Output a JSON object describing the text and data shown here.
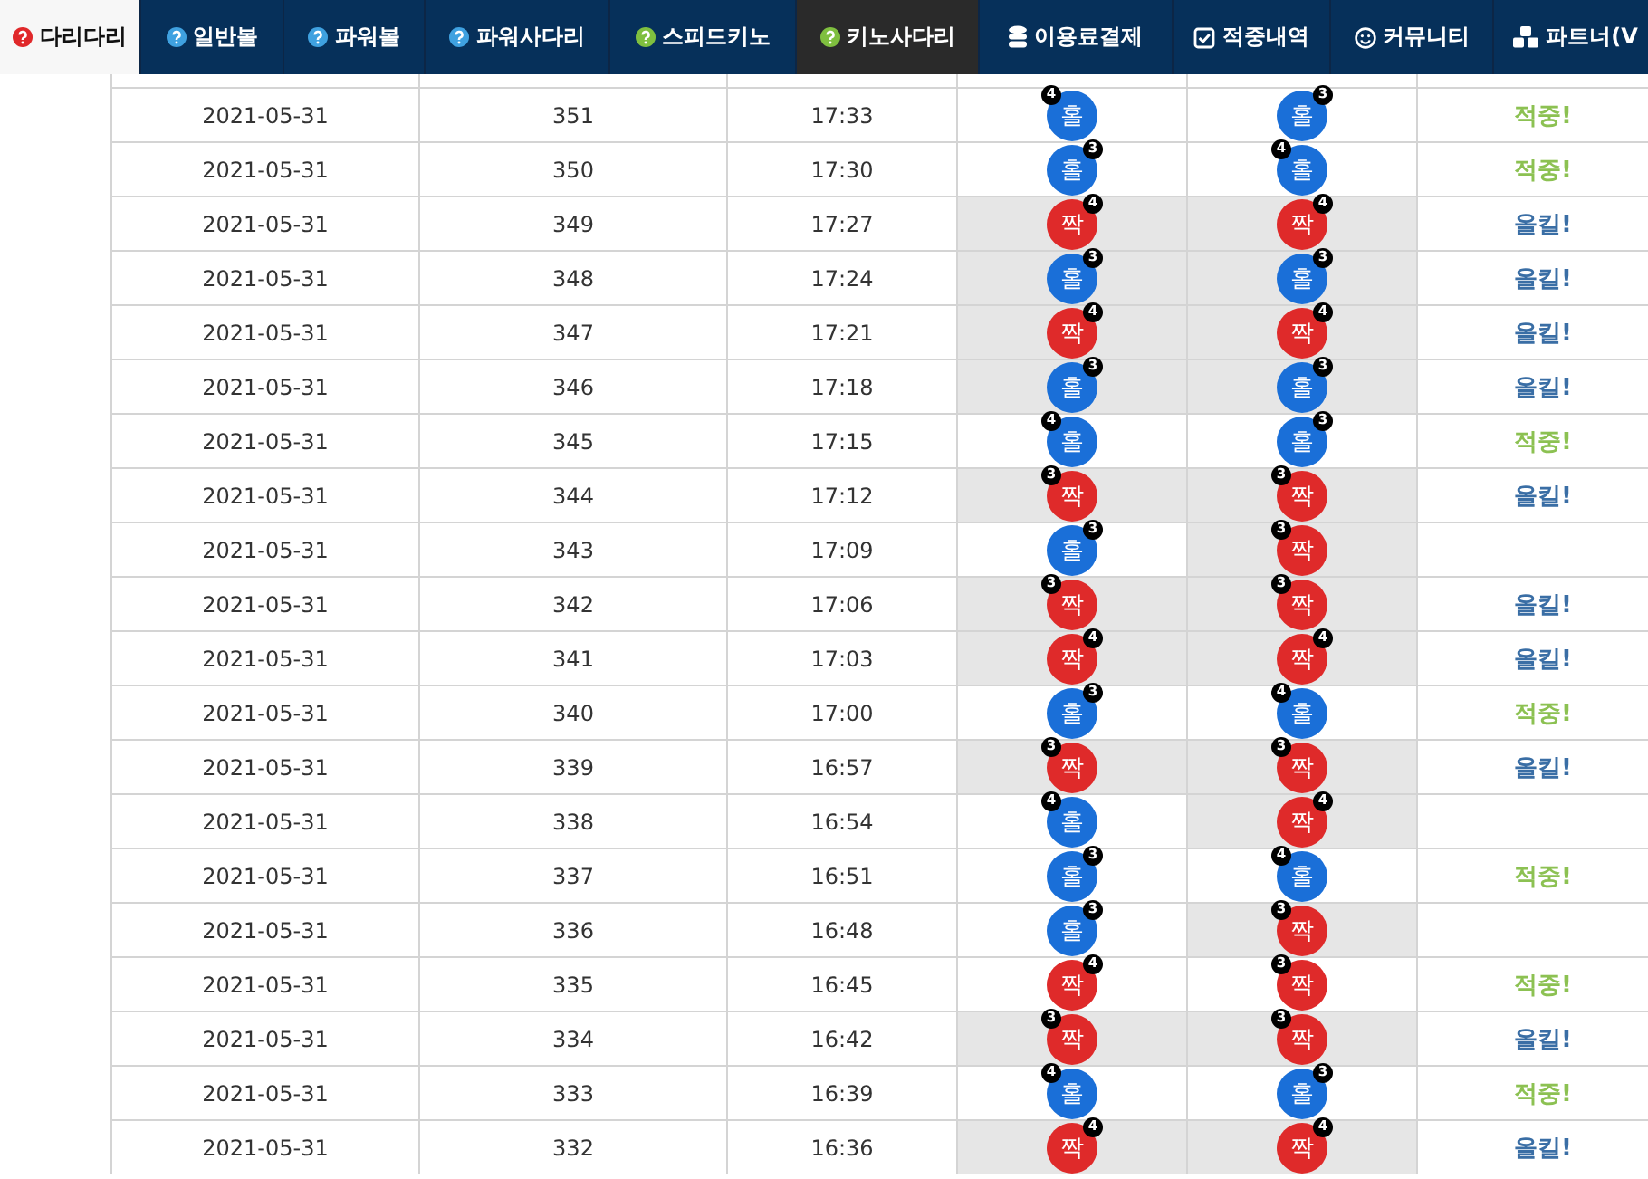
{
  "nav": {
    "tabs": [
      {
        "label": "다리다리",
        "kind": "question",
        "color": "#e0282a",
        "selected": true,
        "dark": false
      },
      {
        "label": "일반볼",
        "kind": "question",
        "color": "#3fa1e0",
        "selected": false,
        "dark": false
      },
      {
        "label": "파워볼",
        "kind": "question",
        "color": "#3fa1e0",
        "selected": false,
        "dark": false
      },
      {
        "label": "파워사다리",
        "kind": "question",
        "color": "#3fa1e0",
        "selected": false,
        "dark": false
      },
      {
        "label": "스피드키노",
        "kind": "question",
        "color": "#7fbf3f",
        "selected": false,
        "dark": false
      },
      {
        "label": "키노사다리",
        "kind": "question",
        "color": "#7fbf3f",
        "selected": false,
        "dark": true
      },
      {
        "label": "이용료결제",
        "kind": "database",
        "selected": false,
        "dark": false
      },
      {
        "label": "적중내역",
        "kind": "check",
        "selected": false,
        "dark": false
      },
      {
        "label": "커뮤니티",
        "kind": "smile",
        "selected": false,
        "dark": false
      },
      {
        "label": "파트너(V",
        "kind": "cubes",
        "selected": false,
        "dark": false
      }
    ]
  },
  "table": {
    "rows": [
      {
        "date": "2021-05-31",
        "round": "351",
        "time": "17:33",
        "left": {
          "result": "홀",
          "kind": "odd",
          "lines": "4",
          "badge_left": true,
          "shaded": false
        },
        "right": {
          "result": "홀",
          "kind": "odd",
          "lines": "3",
          "badge_left": false,
          "shaded": false
        },
        "outcome": {
          "text": "적중!",
          "kind": "hit"
        }
      },
      {
        "date": "2021-05-31",
        "round": "350",
        "time": "17:30",
        "left": {
          "result": "홀",
          "kind": "odd",
          "lines": "3",
          "badge_left": false,
          "shaded": false
        },
        "right": {
          "result": "홀",
          "kind": "odd",
          "lines": "4",
          "badge_left": true,
          "shaded": false
        },
        "outcome": {
          "text": "적중!",
          "kind": "hit"
        }
      },
      {
        "date": "2021-05-31",
        "round": "349",
        "time": "17:27",
        "left": {
          "result": "짝",
          "kind": "even",
          "lines": "4",
          "badge_left": false,
          "shaded": true
        },
        "right": {
          "result": "짝",
          "kind": "even",
          "lines": "4",
          "badge_left": false,
          "shaded": true
        },
        "outcome": {
          "text": "올킬!",
          "kind": "allkill"
        }
      },
      {
        "date": "2021-05-31",
        "round": "348",
        "time": "17:24",
        "left": {
          "result": "홀",
          "kind": "odd",
          "lines": "3",
          "badge_left": false,
          "shaded": true
        },
        "right": {
          "result": "홀",
          "kind": "odd",
          "lines": "3",
          "badge_left": false,
          "shaded": true
        },
        "outcome": {
          "text": "올킬!",
          "kind": "allkill"
        }
      },
      {
        "date": "2021-05-31",
        "round": "347",
        "time": "17:21",
        "left": {
          "result": "짝",
          "kind": "even",
          "lines": "4",
          "badge_left": false,
          "shaded": true
        },
        "right": {
          "result": "짝",
          "kind": "even",
          "lines": "4",
          "badge_left": false,
          "shaded": true
        },
        "outcome": {
          "text": "올킬!",
          "kind": "allkill"
        }
      },
      {
        "date": "2021-05-31",
        "round": "346",
        "time": "17:18",
        "left": {
          "result": "홀",
          "kind": "odd",
          "lines": "3",
          "badge_left": false,
          "shaded": true
        },
        "right": {
          "result": "홀",
          "kind": "odd",
          "lines": "3",
          "badge_left": false,
          "shaded": true
        },
        "outcome": {
          "text": "올킬!",
          "kind": "allkill"
        }
      },
      {
        "date": "2021-05-31",
        "round": "345",
        "time": "17:15",
        "left": {
          "result": "홀",
          "kind": "odd",
          "lines": "4",
          "badge_left": true,
          "shaded": false
        },
        "right": {
          "result": "홀",
          "kind": "odd",
          "lines": "3",
          "badge_left": false,
          "shaded": false
        },
        "outcome": {
          "text": "적중!",
          "kind": "hit"
        }
      },
      {
        "date": "2021-05-31",
        "round": "344",
        "time": "17:12",
        "left": {
          "result": "짝",
          "kind": "even",
          "lines": "3",
          "badge_left": true,
          "shaded": true
        },
        "right": {
          "result": "짝",
          "kind": "even",
          "lines": "3",
          "badge_left": true,
          "shaded": true
        },
        "outcome": {
          "text": "올킬!",
          "kind": "allkill"
        }
      },
      {
        "date": "2021-05-31",
        "round": "343",
        "time": "17:09",
        "left": {
          "result": "홀",
          "kind": "odd",
          "lines": "3",
          "badge_left": false,
          "shaded": false
        },
        "right": {
          "result": "짝",
          "kind": "even",
          "lines": "3",
          "badge_left": true,
          "shaded": true
        }
      },
      {
        "date": "2021-05-31",
        "round": "342",
        "time": "17:06",
        "left": {
          "result": "짝",
          "kind": "even",
          "lines": "3",
          "badge_left": true,
          "shaded": true
        },
        "right": {
          "result": "짝",
          "kind": "even",
          "lines": "3",
          "badge_left": true,
          "shaded": true
        },
        "outcome": {
          "text": "올킬!",
          "kind": "allkill"
        }
      },
      {
        "date": "2021-05-31",
        "round": "341",
        "time": "17:03",
        "left": {
          "result": "짝",
          "kind": "even",
          "lines": "4",
          "badge_left": false,
          "shaded": true
        },
        "right": {
          "result": "짝",
          "kind": "even",
          "lines": "4",
          "badge_left": false,
          "shaded": true
        },
        "outcome": {
          "text": "올킬!",
          "kind": "allkill"
        }
      },
      {
        "date": "2021-05-31",
        "round": "340",
        "time": "17:00",
        "left": {
          "result": "홀",
          "kind": "odd",
          "lines": "3",
          "badge_left": false,
          "shaded": false
        },
        "right": {
          "result": "홀",
          "kind": "odd",
          "lines": "4",
          "badge_left": true,
          "shaded": false
        },
        "outcome": {
          "text": "적중!",
          "kind": "hit"
        }
      },
      {
        "date": "2021-05-31",
        "round": "339",
        "time": "16:57",
        "left": {
          "result": "짝",
          "kind": "even",
          "lines": "3",
          "badge_left": true,
          "shaded": true
        },
        "right": {
          "result": "짝",
          "kind": "even",
          "lines": "3",
          "badge_left": true,
          "shaded": true
        },
        "outcome": {
          "text": "올킬!",
          "kind": "allkill"
        }
      },
      {
        "date": "2021-05-31",
        "round": "338",
        "time": "16:54",
        "left": {
          "result": "홀",
          "kind": "odd",
          "lines": "4",
          "badge_left": true,
          "shaded": false
        },
        "right": {
          "result": "짝",
          "kind": "even",
          "lines": "4",
          "badge_left": false,
          "shaded": true
        }
      },
      {
        "date": "2021-05-31",
        "round": "337",
        "time": "16:51",
        "left": {
          "result": "홀",
          "kind": "odd",
          "lines": "3",
          "badge_left": false,
          "shaded": false
        },
        "right": {
          "result": "홀",
          "kind": "odd",
          "lines": "4",
          "badge_left": true,
          "shaded": false
        },
        "outcome": {
          "text": "적중!",
          "kind": "hit"
        }
      },
      {
        "date": "2021-05-31",
        "round": "336",
        "time": "16:48",
        "left": {
          "result": "홀",
          "kind": "odd",
          "lines": "3",
          "badge_left": false,
          "shaded": false
        },
        "right": {
          "result": "짝",
          "kind": "even",
          "lines": "3",
          "badge_left": true,
          "shaded": true
        }
      },
      {
        "date": "2021-05-31",
        "round": "335",
        "time": "16:45",
        "left": {
          "result": "짝",
          "kind": "even",
          "lines": "4",
          "badge_left": false,
          "shaded": false
        },
        "right": {
          "result": "짝",
          "kind": "even",
          "lines": "3",
          "badge_left": true,
          "shaded": false
        },
        "outcome": {
          "text": "적중!",
          "kind": "hit"
        }
      },
      {
        "date": "2021-05-31",
        "round": "334",
        "time": "16:42",
        "left": {
          "result": "짝",
          "kind": "even",
          "lines": "3",
          "badge_left": true,
          "shaded": true
        },
        "right": {
          "result": "짝",
          "kind": "even",
          "lines": "3",
          "badge_left": true,
          "shaded": true
        },
        "outcome": {
          "text": "올킬!",
          "kind": "allkill"
        }
      },
      {
        "date": "2021-05-31",
        "round": "333",
        "time": "16:39",
        "left": {
          "result": "홀",
          "kind": "odd",
          "lines": "4",
          "badge_left": true,
          "shaded": false
        },
        "right": {
          "result": "홀",
          "kind": "odd",
          "lines": "3",
          "badge_left": false,
          "shaded": false
        },
        "outcome": {
          "text": "적중!",
          "kind": "hit"
        }
      },
      {
        "date": "2021-05-31",
        "round": "332",
        "time": "16:36",
        "left": {
          "result": "짝",
          "kind": "even",
          "lines": "4",
          "badge_left": false,
          "shaded": true
        },
        "right": {
          "result": "짝",
          "kind": "even",
          "lines": "4",
          "badge_left": false,
          "shaded": true
        },
        "outcome": {
          "text": "올킬!",
          "kind": "allkill"
        }
      }
    ]
  }
}
